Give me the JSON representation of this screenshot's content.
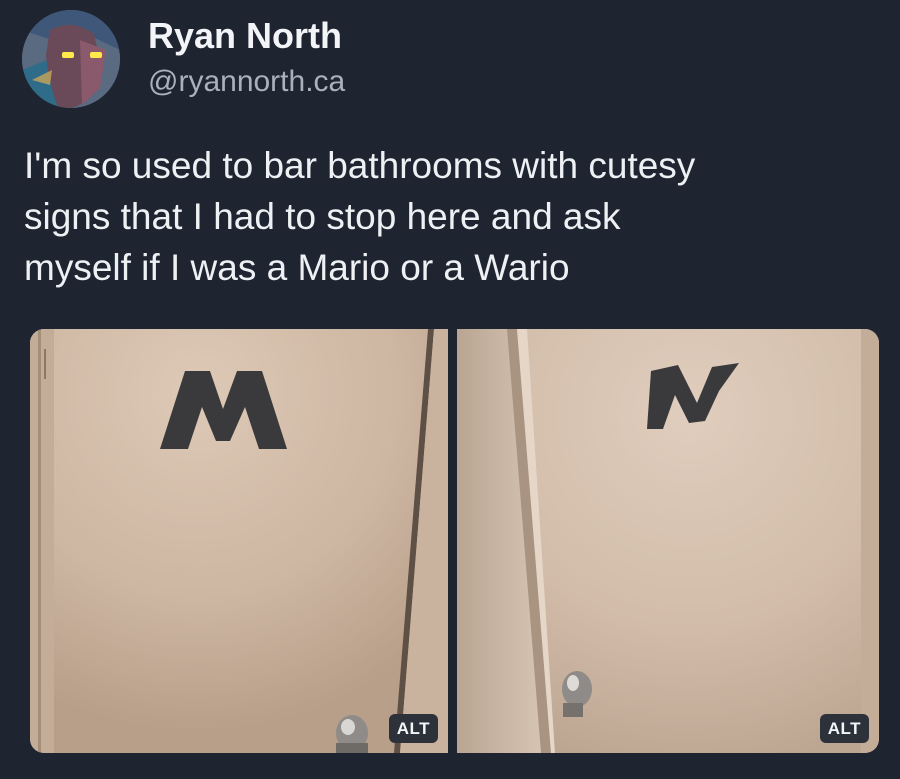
{
  "author": {
    "display_name": "Ryan North",
    "handle": "@ryannorth.ca",
    "avatar_icon": "user-avatar"
  },
  "post": {
    "text_lines": [
      "I'm so used to bar bathrooms with cutesy",
      "signs that I had to stop here and ask",
      "myself if I was a Mario or a Wario"
    ]
  },
  "media": [
    {
      "sign_letter": "M",
      "alt_label": "ALT",
      "door_color": "#d1bba8"
    },
    {
      "sign_letter": "W",
      "alt_label": "ALT",
      "door_color": "#d6c2b1"
    }
  ],
  "colors": {
    "background": "#1e2430",
    "text": "#eef1f4",
    "handle": "#a9b1bd",
    "sign_tape": "#3a3a3d"
  }
}
